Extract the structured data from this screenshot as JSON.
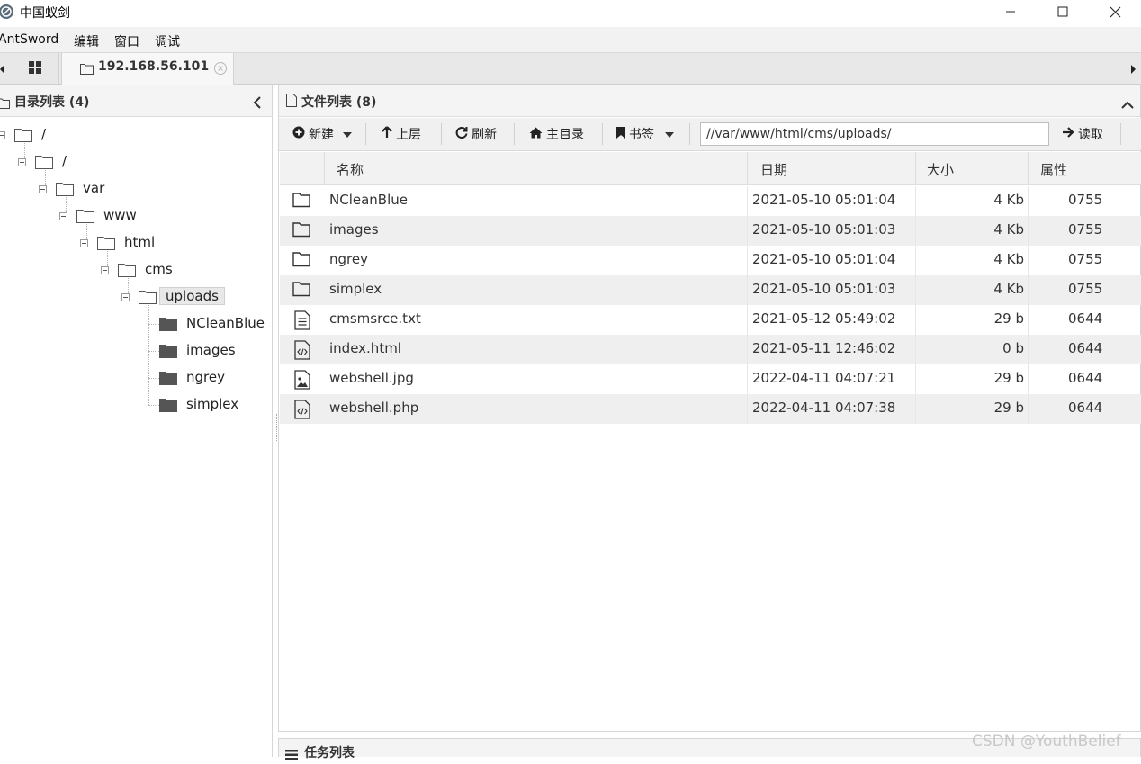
{
  "window": {
    "title": "中国蚁剑",
    "icon": "antsword-logo-icon",
    "controls": [
      "minimize-icon",
      "maximize-icon",
      "close-icon"
    ]
  },
  "menu": {
    "items": [
      "AntSword",
      "编辑",
      "窗口",
      "调试"
    ]
  },
  "tabs": {
    "home_icon": "grid-icon",
    "active_tab": {
      "label": "192.168.56.101",
      "icon": "folder-icon",
      "close_icon": "close-circle-icon"
    }
  },
  "left_panel": {
    "title": "目录列表 (4)",
    "collapse_icon": "chevron-left-icon",
    "tree": [
      {
        "label": "/",
        "level": 0,
        "expanded": true,
        "selected": false
      },
      {
        "label": "/",
        "level": 1,
        "expanded": true,
        "selected": false
      },
      {
        "label": "var",
        "level": 2,
        "expanded": true,
        "selected": false
      },
      {
        "label": "www",
        "level": 3,
        "expanded": true,
        "selected": false
      },
      {
        "label": "html",
        "level": 4,
        "expanded": true,
        "selected": false
      },
      {
        "label": "cms",
        "level": 5,
        "expanded": true,
        "selected": false
      },
      {
        "label": "uploads",
        "level": 6,
        "expanded": true,
        "selected": true
      },
      {
        "label": "NCleanBlue",
        "level": 7,
        "leaf": true
      },
      {
        "label": "images",
        "level": 7,
        "leaf": true
      },
      {
        "label": "ngrey",
        "level": 7,
        "leaf": true
      },
      {
        "label": "simplex",
        "level": 7,
        "leaf": true
      }
    ]
  },
  "right_panel": {
    "title": "文件列表 (8)",
    "collapse_icon": "chevron-up-icon",
    "toolbar": {
      "new_label": "新建",
      "up_label": "上层",
      "refresh_label": "刷新",
      "home_label": "主目录",
      "bookmark_label": "书签",
      "path_value": "//var/www/html/cms/uploads/",
      "read_label": "读取"
    },
    "columns": [
      "名称",
      "日期",
      "大小",
      "属性"
    ],
    "files": [
      {
        "name": "NCleanBlue",
        "date": "2021-05-10 05:01:04",
        "size": "4 Kb",
        "perm": "0755",
        "icon": "folder-icon"
      },
      {
        "name": "images",
        "date": "2021-05-10 05:01:03",
        "size": "4 Kb",
        "perm": "0755",
        "icon": "folder-icon"
      },
      {
        "name": "ngrey",
        "date": "2021-05-10 05:01:04",
        "size": "4 Kb",
        "perm": "0755",
        "icon": "folder-icon"
      },
      {
        "name": "simplex",
        "date": "2021-05-10 05:01:03",
        "size": "4 Kb",
        "perm": "0755",
        "icon": "folder-icon"
      },
      {
        "name": "cmsmsrce.txt",
        "date": "2021-05-12 05:49:02",
        "size": "29 b",
        "perm": "0644",
        "icon": "text-file-icon"
      },
      {
        "name": "index.html",
        "date": "2021-05-11 12:46:02",
        "size": "0 b",
        "perm": "0644",
        "icon": "code-file-icon"
      },
      {
        "name": "webshell.jpg",
        "date": "2022-04-11 04:07:21",
        "size": "29 b",
        "perm": "0644",
        "icon": "image-file-icon"
      },
      {
        "name": "webshell.php",
        "date": "2022-04-11 04:07:38",
        "size": "29 b",
        "perm": "0644",
        "icon": "code-file-icon"
      }
    ]
  },
  "task_panel": {
    "title": "任务列表",
    "icon": "list-icon"
  },
  "watermark": "CSDN @YouthBelief"
}
